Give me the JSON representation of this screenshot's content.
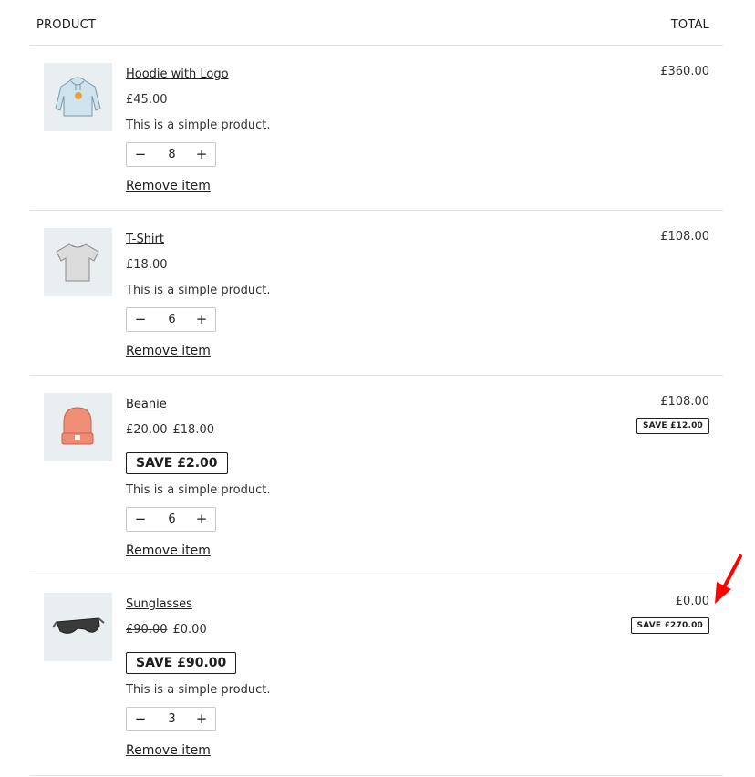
{
  "header": {
    "product": "PRODUCT",
    "total": "TOTAL"
  },
  "items": [
    {
      "name": "Hoodie with Logo",
      "price": "£45.00",
      "description": "This is a simple product.",
      "qty_minus": "−",
      "quantity": "8",
      "qty_plus": "+",
      "remove": "Remove item",
      "total": "£360.00",
      "image_icon": "hoodie-icon"
    },
    {
      "name": "T-Shirt",
      "price": "£18.00",
      "description": "This is a simple product.",
      "qty_minus": "−",
      "quantity": "6",
      "qty_plus": "+",
      "remove": "Remove item",
      "total": "£108.00",
      "image_icon": "tshirt-icon"
    },
    {
      "name": "Beanie",
      "old_price": "£20.00",
      "price": "£18.00",
      "save_badge": "SAVE £2.00",
      "description": "This is a simple product.",
      "qty_minus": "−",
      "quantity": "6",
      "qty_plus": "+",
      "remove": "Remove item",
      "total": "£108.00",
      "total_save": "SAVE £12.00",
      "image_icon": "beanie-icon"
    },
    {
      "name": "Sunglasses",
      "old_price": "£90.00",
      "price": "£0.00",
      "save_badge": "SAVE £90.00",
      "description": "This is a simple product.",
      "qty_minus": "−",
      "quantity": "3",
      "qty_plus": "+",
      "remove": "Remove item",
      "total": "£0.00",
      "total_save": "SAVE £270.00",
      "image_icon": "sunglasses-icon"
    }
  ],
  "colors": {
    "border": "#e2e2e2",
    "thumb_bg": "#e9eef1",
    "annotation_arrow": "#ff0000"
  },
  "annotation": {
    "icon": "red-arrow-icon"
  }
}
